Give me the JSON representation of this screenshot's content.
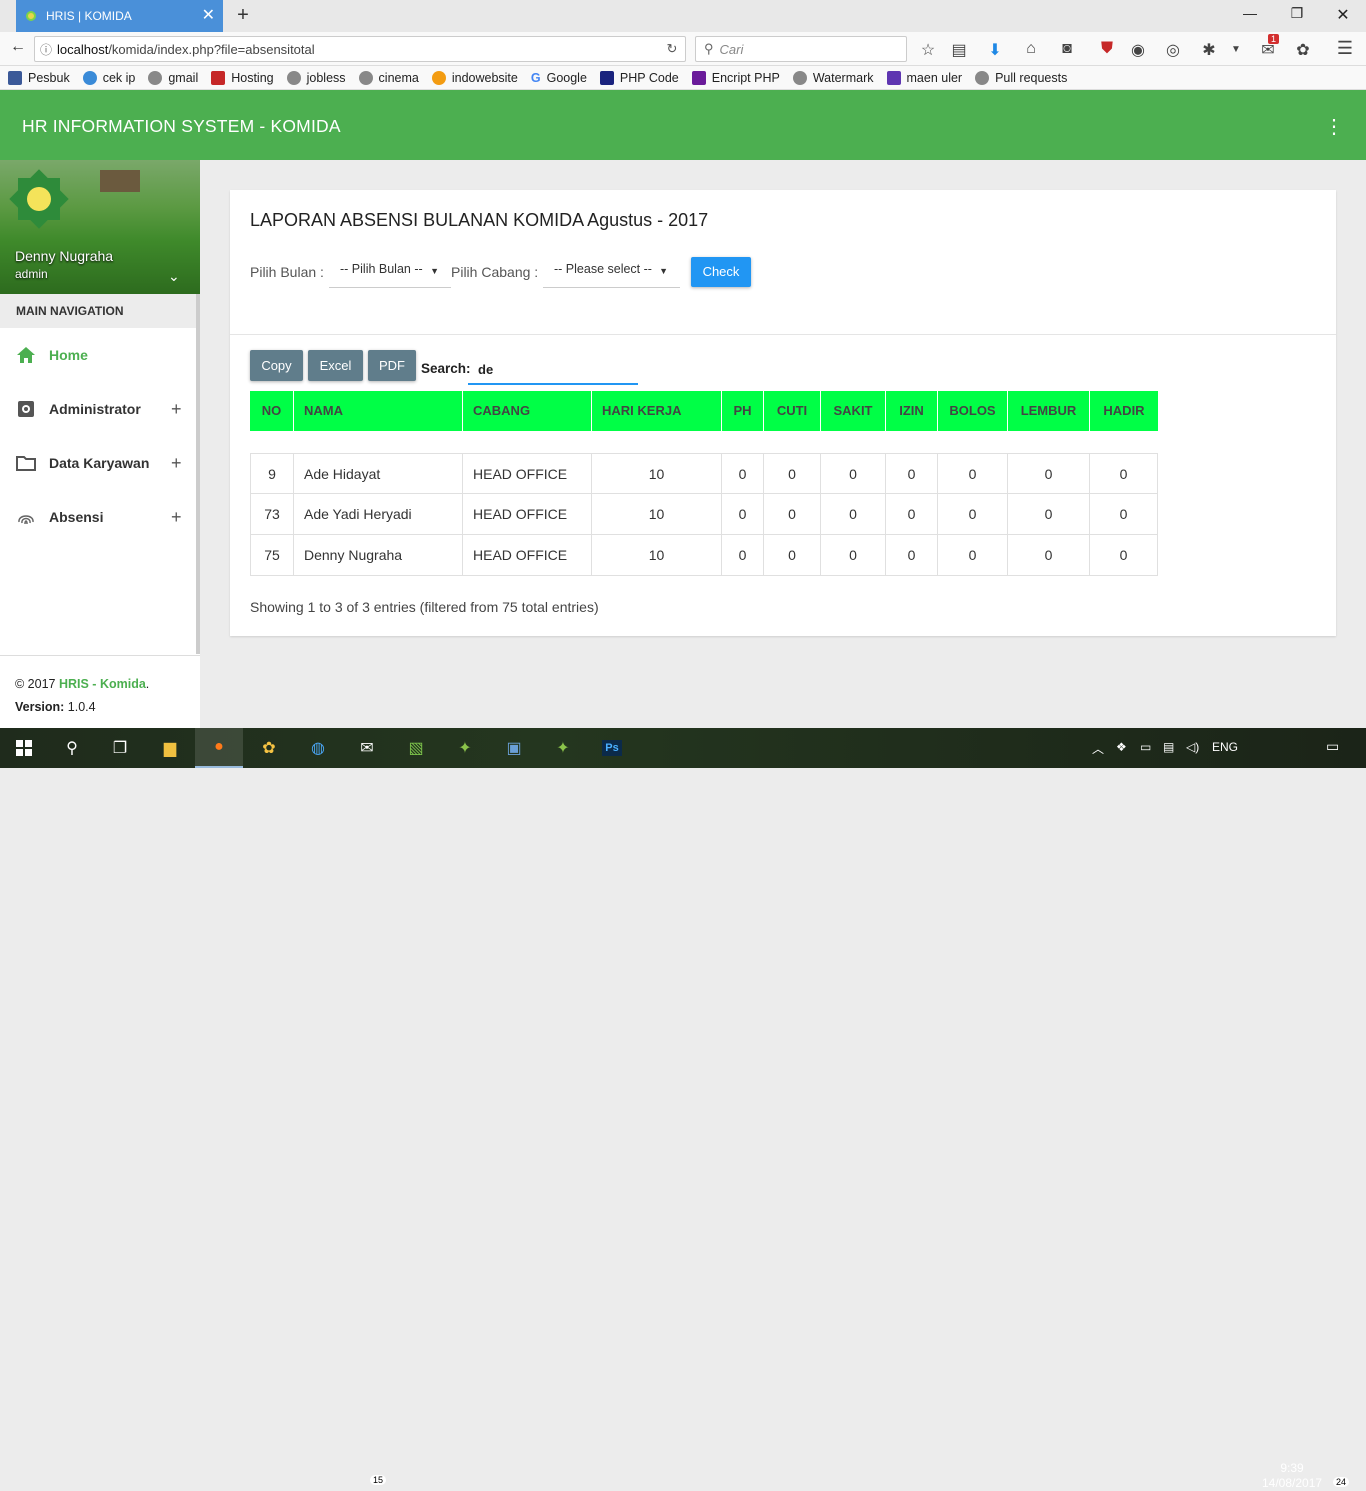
{
  "browser": {
    "tab_title": "HRIS | KOMIDA",
    "url_prefix": "localhost",
    "url_rest": "/komida/index.php?file=absensitotal",
    "search_placeholder": "Cari",
    "badge_count": "1",
    "badge_count2": "1"
  },
  "bookmarks": [
    "Pesbuk",
    "cek ip",
    "gmail",
    "Hosting",
    "jobless",
    "cinema",
    "indowebsite",
    "Google",
    "PHP Code",
    "Encript PHP",
    "Watermark",
    "maen uler",
    "Pull requests"
  ],
  "app": {
    "title": "HR INFORMATION SYSTEM - KOMIDA"
  },
  "sidebar": {
    "user_name": "Denny Nugraha",
    "user_role": "admin",
    "section_title": "MAIN NAVIGATION",
    "items": [
      {
        "label": "Home"
      },
      {
        "label": "Administrator"
      },
      {
        "label": "Data Karyawan"
      },
      {
        "label": "Absensi"
      }
    ],
    "footer_copy": "© 2017 ",
    "footer_brand": "HRIS - Komida",
    "footer_dot": ".",
    "version_label": "Version:",
    "version_value": " 1.0.4"
  },
  "report": {
    "title": "LAPORAN ABSENSI BULANAN KOMIDA Agustus - 2017",
    "bulan_label": "Pilih Bulan :",
    "bulan_value": "-- Pilih Bulan --",
    "cabang_label": "Pilih Cabang :",
    "cabang_value": "-- Please select --",
    "check_label": "Check",
    "copy_label": "Copy",
    "excel_label": "Excel",
    "pdf_label": "PDF",
    "search_label": "Search:",
    "search_value": "de",
    "columns": [
      "NO",
      "NAMA",
      "CABANG",
      "HARI KERJA",
      "PH",
      "CUTI",
      "SAKIT",
      "IZIN",
      "BOLOS",
      "LEMBUR",
      "HADIR"
    ],
    "rows": [
      [
        "9",
        "Ade Hidayat",
        "HEAD OFFICE",
        "10",
        "0",
        "0",
        "0",
        "0",
        "0",
        "0",
        "0"
      ],
      [
        "73",
        "Ade Yadi Heryadi",
        "HEAD OFFICE",
        "10",
        "0",
        "0",
        "0",
        "0",
        "0",
        "0",
        "0"
      ],
      [
        "75",
        "Denny Nugraha",
        "HEAD OFFICE",
        "10",
        "0",
        "0",
        "0",
        "0",
        "0",
        "0",
        "0"
      ]
    ],
    "info": "Showing 1 to 3 of 3 entries (filtered from 75 total entries)"
  },
  "taskbar": {
    "mail_badge": "15",
    "lang": "ENG",
    "time": "9:39",
    "date": "14/08/2017",
    "notif_count": "24"
  },
  "colors": {
    "header_green": "#4caf50",
    "table_head": "#00ff46",
    "check_blue": "#2196f3",
    "dt_button": "#607d8b"
  }
}
